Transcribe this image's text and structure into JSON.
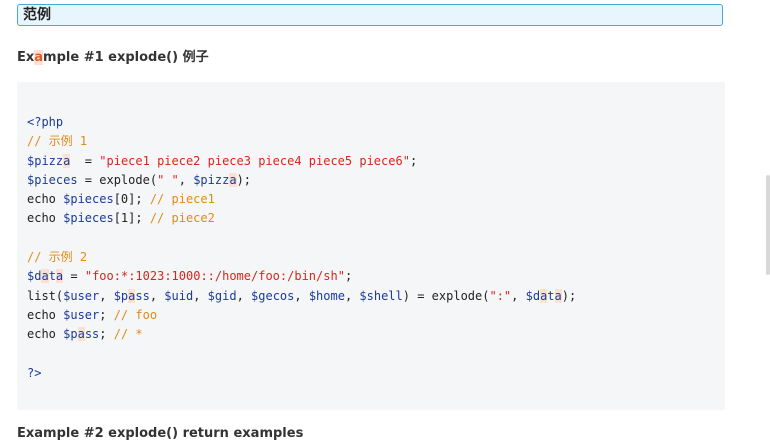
{
  "section": {
    "title": "范例"
  },
  "example1": {
    "title_pre": "Ex",
    "title_hl": "a",
    "title_post": "mple #1 explode() 例子"
  },
  "example2": {
    "title": "Example #2 explode() return examples"
  },
  "code": {
    "open_tag": "<?php",
    "comment1": "// 示例 1",
    "l3_var": "$pizz",
    "l3_var_hl": "a",
    "l3_mid": "  = ",
    "l3_str": "\"piece1 piece2 piece3 piece4 piece5 piece6\"",
    "l3_end": ";",
    "l4_var": "$pieces",
    "l4_mid": " = explode(",
    "l4_str": "\" \"",
    "l4_comma": ", ",
    "l4_var2": "$pizz",
    "l4_var2_hl": "a",
    "l4_end": ");",
    "l5_pre": "echo ",
    "l5_var": "$pieces",
    "l5_idx": "[0]; ",
    "l5_cm": "// piece1",
    "l6_pre": "echo ",
    "l6_var": "$pieces",
    "l6_idx": "[1]; ",
    "l6_cm": "// piece2",
    "comment2": "// 示例 2",
    "l9_var_a": "$d",
    "l9_hl1": "a",
    "l9_var_b": "t",
    "l9_hl2": "a",
    "l9_mid": " = ",
    "l9_str": "\"foo:*:1023:1000::/home/foo:/bin/sh\"",
    "l9_end": ";",
    "l10_pre": "list(",
    "l10_user": "$user",
    "l10_c1": ", ",
    "l10_p_a": "$p",
    "l10_p_hl": "a",
    "l10_p_b": "ss",
    "l10_c2": ", ",
    "l10_uid": "$uid",
    "l10_c3": ", ",
    "l10_gid": "$gid",
    "l10_c4": ", ",
    "l10_gecos": "$gecos",
    "l10_c5": ", ",
    "l10_home": "$home",
    "l10_c6": ", ",
    "l10_shell": "$shell",
    "l10_mid": ") = explode(",
    "l10_str": "\":\"",
    "l10_c7": ", ",
    "l10_d_a": "$d",
    "l10_d_hl1": "a",
    "l10_d_b": "t",
    "l10_d_hl2": "a",
    "l10_end": ");",
    "l11_pre": "echo ",
    "l11_var": "$user",
    "l11_semi": "; ",
    "l11_cm": "// foo",
    "l12_pre": "echo ",
    "l12_var_a": "$p",
    "l12_hl": "a",
    "l12_var_b": "ss",
    "l12_semi": "; ",
    "l12_cm": "// *",
    "close_tag": "?>"
  }
}
